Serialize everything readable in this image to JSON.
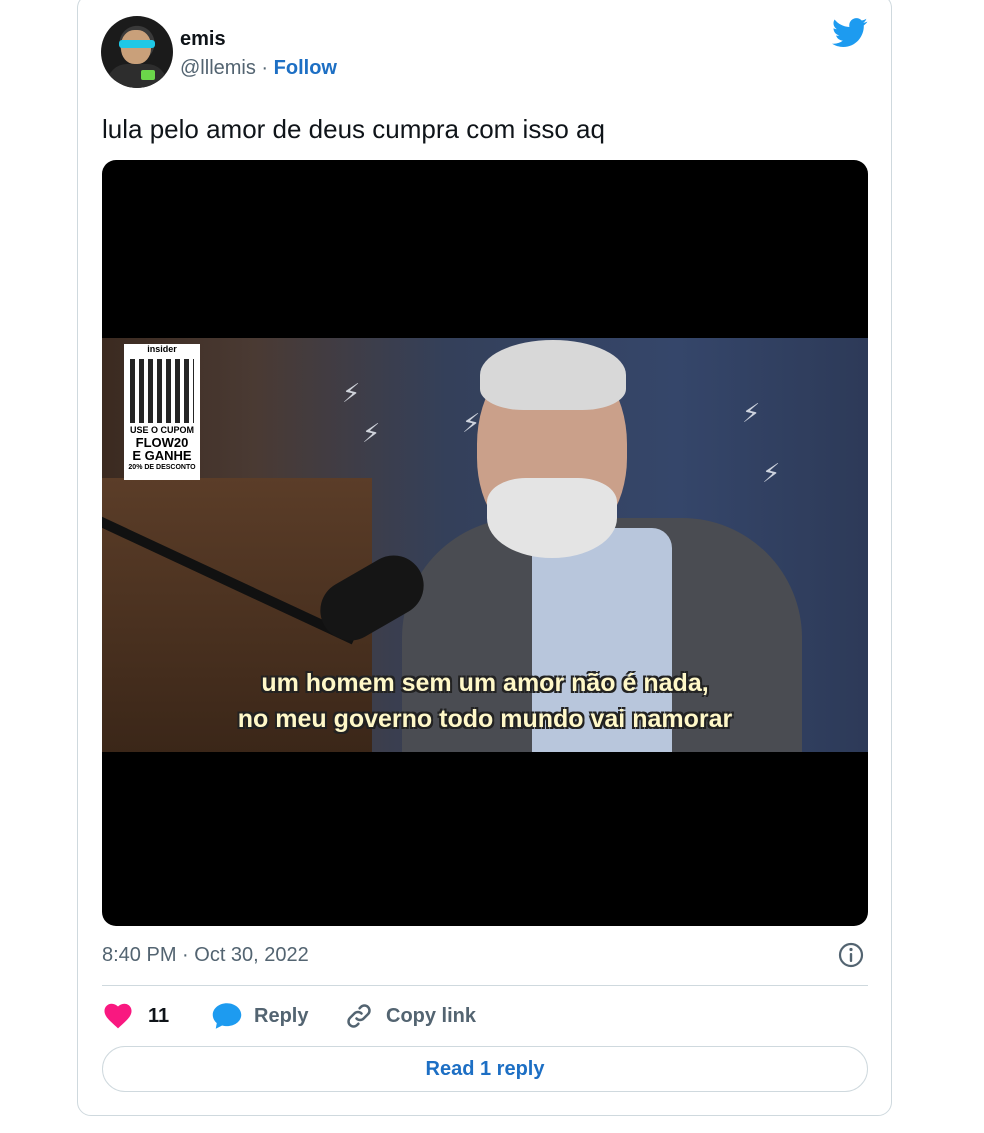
{
  "tweet": {
    "author": {
      "display_name": "emis",
      "handle": "@lllemis",
      "separator": " · ",
      "follow_label": "Follow"
    },
    "text": "lula pelo amor de deus cumpra com isso aq",
    "media": {
      "promo_brand": "insider",
      "promo_line1": "USE O CUPOM",
      "promo_code1": "FLOW20",
      "promo_code2": "E GANHE",
      "promo_line2": "20% DE DESCONTO",
      "subtitle_line1": "um homem sem um amor não é nada,",
      "subtitle_line2": "no meu governo todo mundo vai namorar"
    },
    "timestamp": "8:40 PM · Oct 30, 2022",
    "actions": {
      "like_count": "11",
      "reply_label": "Reply",
      "copy_link_label": "Copy link"
    },
    "read_replies_label": "Read 1 reply"
  },
  "colors": {
    "brand_blue": "#1d9bf0",
    "link_blue": "#1d6fc4",
    "like_pink": "#f91880",
    "muted": "#536471"
  },
  "icons": [
    "twitter-bird-icon",
    "info-icon",
    "heart-icon",
    "reply-bubble-icon",
    "link-icon"
  ]
}
